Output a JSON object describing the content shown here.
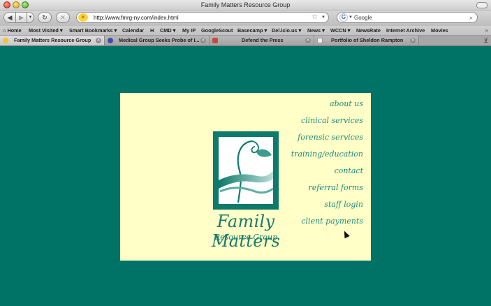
{
  "window": {
    "title": "Family Matters Resource Group"
  },
  "toolbar": {
    "url": "http://www.fmrg-ny.com/index.html",
    "search_placeholder": "Google"
  },
  "bookmarks": [
    "Home",
    "Most Visited ▾",
    "Smart Bookmarks ▾",
    "Calendar",
    "H",
    "CMD ▾",
    "My IP",
    "GoogleScout",
    "Basecamp ▾",
    "Del.icio.us ▾",
    "News ▾",
    "WCCN ▾",
    "NewsRate",
    "Internet Archive",
    "Movies"
  ],
  "tabs": [
    {
      "label": "Family Matters Resource Group",
      "active": true,
      "favicon_color": "#f2c230"
    },
    {
      "label": "Medical Group Seeks Probe of I...",
      "active": false,
      "favicon_color": "#3a4fb0"
    },
    {
      "label": "Defend the Press",
      "active": false,
      "favicon_color": "#c84a3a"
    },
    {
      "label": "Portfolio of Sheldon Rampton",
      "active": false,
      "favicon_color": "#e8e8e8"
    }
  ],
  "page": {
    "brand_title": "Family Matters",
    "brand_subtitle": "Resource Group",
    "nav": [
      "about us",
      "clinical services",
      "forensic services",
      "training/education",
      "contact",
      "referral forms",
      "staff login",
      "client payments"
    ]
  },
  "colors": {
    "background": "#007366",
    "panel": "#ffffc7",
    "brand": "#167a6e"
  }
}
